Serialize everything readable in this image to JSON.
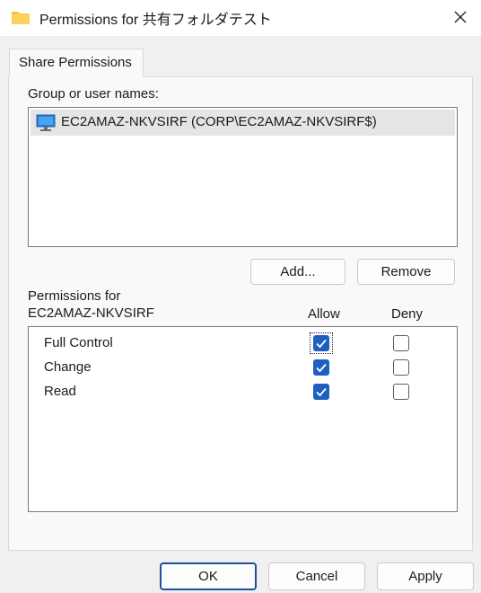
{
  "window": {
    "title": "Permissions for 共有フォルダテスト"
  },
  "tabs": [
    {
      "label": "Share Permissions"
    }
  ],
  "group_section": {
    "label": "Group or user names:",
    "items": [
      {
        "label": "EC2AMAZ-NKVSIRF (CORP\\EC2AMAZ-NKVSIRF$)",
        "icon": "computer-icon"
      }
    ]
  },
  "actions": {
    "add_label": "Add...",
    "remove_label": "Remove"
  },
  "permissions": {
    "header_line1": "Permissions for",
    "header_line2": "EC2AMAZ-NKVSIRF",
    "allow_label": "Allow",
    "deny_label": "Deny",
    "rows": [
      {
        "name": "Full Control",
        "allow": true,
        "deny": false
      },
      {
        "name": "Change",
        "allow": true,
        "deny": false
      },
      {
        "name": "Read",
        "allow": true,
        "deny": false
      }
    ]
  },
  "footer": {
    "ok_label": "OK",
    "cancel_label": "Cancel",
    "apply_label": "Apply"
  },
  "colors": {
    "accent": "#1f5fbf",
    "selection": "#e5e5e5",
    "folder": "#f5c542"
  }
}
